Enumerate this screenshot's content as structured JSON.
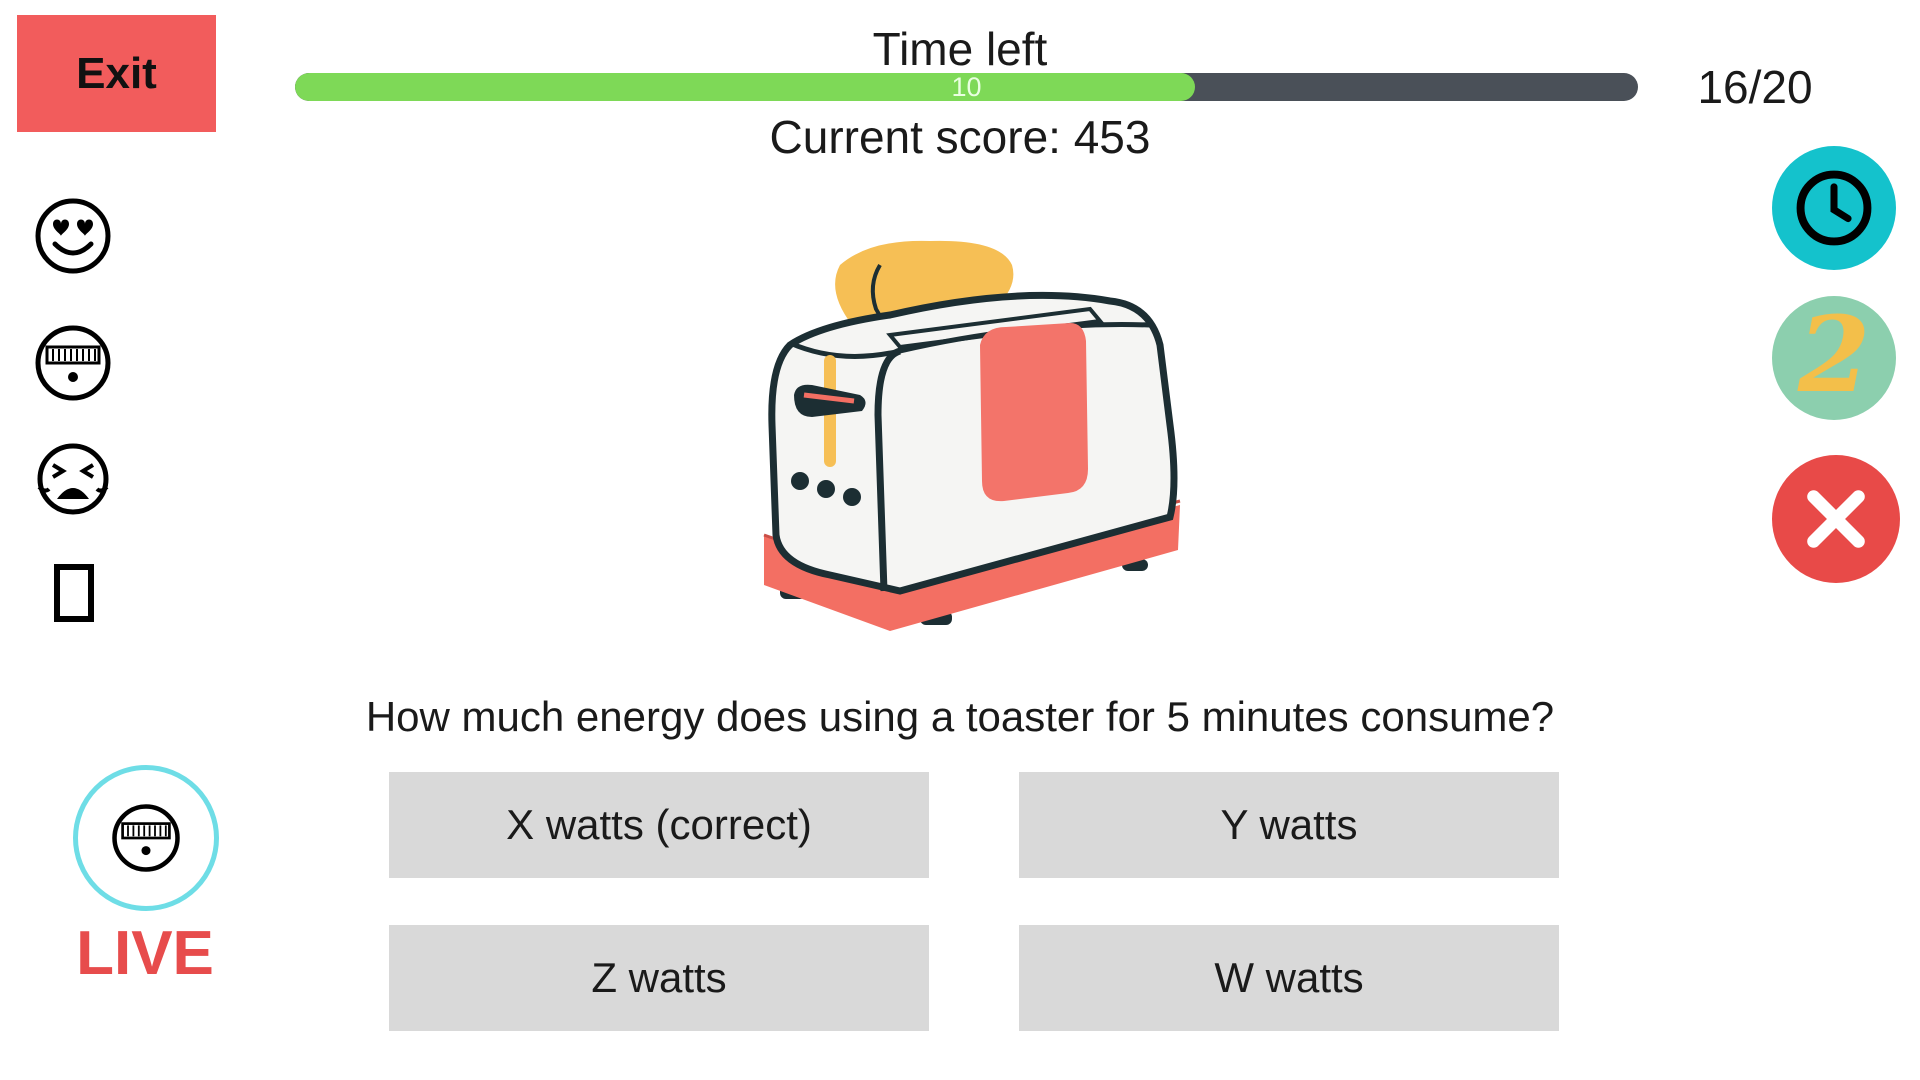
{
  "exit": {
    "label": "Exit"
  },
  "timer": {
    "title": "Time left",
    "value": "10",
    "progress_fraction": 0.67,
    "fill_color": "#7ed957",
    "track_color": "#4a5058"
  },
  "progress": {
    "counter": "16/20"
  },
  "score": {
    "text": "Current score: 453"
  },
  "reactions": [
    {
      "icon": "heart-eyes-face-icon"
    },
    {
      "icon": "bandaged-face-icon"
    },
    {
      "icon": "crying-face-icon"
    },
    {
      "icon": "blank-box-icon"
    }
  ],
  "live": {
    "label": "LIVE",
    "ring_color": "#6edde6",
    "icon": "bandaged-face-icon"
  },
  "powerups": [
    {
      "icon": "clock-icon",
      "color": "#14c2cc"
    },
    {
      "icon": "double-points-icon",
      "label": "2",
      "color": "#8ccfae"
    },
    {
      "icon": "close-icon",
      "color": "#e84a48"
    }
  ],
  "question": {
    "text": "How much energy does using a toaster for 5 minutes consume?"
  },
  "answers": [
    {
      "label": "X watts (correct)"
    },
    {
      "label": "Y watts"
    },
    {
      "label": "Z watts"
    },
    {
      "label": "W watts"
    }
  ]
}
